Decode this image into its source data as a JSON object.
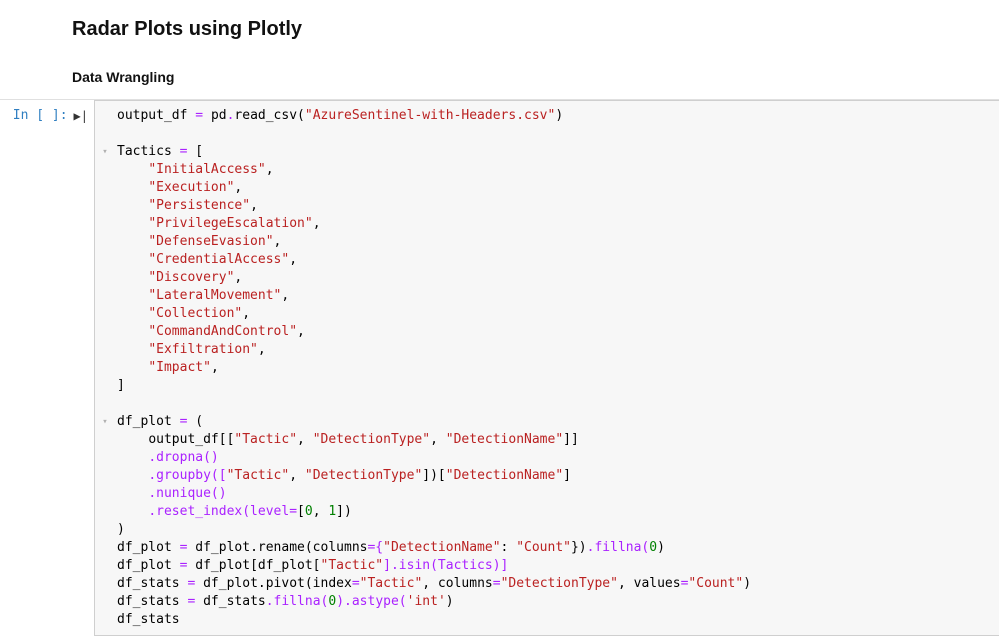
{
  "heading": "Radar Plots using Plotly",
  "subheading": "Data Wrangling",
  "prompt": "In [ ]:",
  "run_glyph": "▶|",
  "fold_glyph_open": "▾",
  "code": {
    "var_output_df": "output_df",
    "assign": "=",
    "pd": "pd",
    "dot": ".",
    "read_csv": "read_csv",
    "lp": "(",
    "rp": ")",
    "csv_file": "\"AzureSentinel-with-Headers.csv\"",
    "tactics_var": "Tactics",
    "lb": "[",
    "rb": "]",
    "tactics": [
      "\"InitialAccess\"",
      "\"Execution\"",
      "\"Persistence\"",
      "\"PrivilegeEscalation\"",
      "\"DefenseEvasion\"",
      "\"CredentialAccess\"",
      "\"Discovery\"",
      "\"LateralMovement\"",
      "\"Collection\"",
      "\"CommandAndControl\"",
      "\"Exfiltration\"",
      "\"Impact\""
    ],
    "df_plot": "df_plot",
    "output_df_sel_open": "output_df[[",
    "col_tactic": "\"Tactic\"",
    "col_dettype": "\"DetectionType\"",
    "col_detname": "\"DetectionName\"",
    "sel_close": "]]",
    "dropna": ".dropna()",
    "groupby_open": ".groupby([",
    "groupby_close": "])[",
    "nunique": ".nunique()",
    "reset_index_open": ".reset_index(level",
    "eq": "=",
    "zero": "0",
    "one": "1",
    "comma": ",",
    "rename_open": "df_plot.rename(columns",
    "dict_open": "={",
    "colon": ": ",
    "col_count": "\"Count\"",
    "dict_close": "})",
    "fillna0": ".fillna(",
    "isin_open": "df_plot[df_plot[",
    "isin_mid": "].isin(Tactics)]",
    "pivot_open": "df_plot.pivot(index",
    "pivot_cols": ", columns",
    "pivot_vals": ", values",
    "df_stats": "df_stats",
    "astype_open": ").astype(",
    "int_str": "'int'",
    "final_expr": "df_stats"
  }
}
